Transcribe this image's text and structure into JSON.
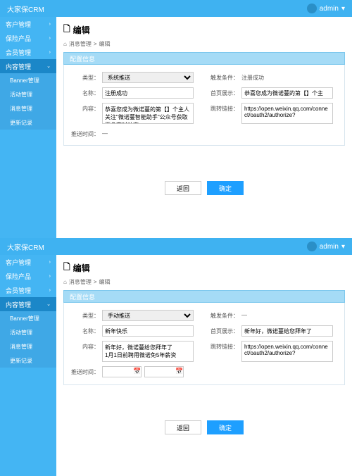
{
  "brand": "大家保CRM",
  "user": "admin",
  "sidebar": [
    {
      "label": "客户管理",
      "type": "top"
    },
    {
      "label": "保险产品",
      "type": "top"
    },
    {
      "label": "会员管理",
      "type": "top"
    },
    {
      "label": "内容管理",
      "type": "expand"
    },
    {
      "label": "Banner管理",
      "type": "sub"
    },
    {
      "label": "活动管理",
      "type": "sub"
    },
    {
      "label": "消息管理",
      "type": "act"
    },
    {
      "label": "更新记录",
      "type": "sub"
    }
  ],
  "page": {
    "icon": "📄",
    "title": "编辑",
    "home": "⌂",
    "bc1": "消息管理",
    "bc2": "编辑",
    "section": "配置信息"
  },
  "labels": {
    "type": "类型：",
    "name": "名称：",
    "content": "内容：",
    "pushTime": "推送时间：",
    "trigger": "触发条件：",
    "homeShow": "首页展示：",
    "jumpLink": "跳转链接："
  },
  "btns": {
    "back": "返回",
    "ok": "确定"
  },
  "inst": [
    {
      "type": "系统推送",
      "name": "注册成功",
      "content": "恭喜您成为微诺蔓的第【】个主人\n关注\"微诺蔓智能助手\"公众号获取更多实时动态",
      "pushTime": "—",
      "trigger": "注册成功",
      "homeShow": "恭喜您成为微诺蔓的第【】个主",
      "jumpLink": "https://open.weixin.qq.com/connect/oauth2/authorize?"
    },
    {
      "type": "手动推送",
      "name": "新年快乐",
      "content": "新年好，微诺蔓给您拜年了\n1月1日前聘用微诺免5年薪资",
      "pushTime": "",
      "trigger": "—",
      "homeShow": "新年好，微诺蔓给您拜年了",
      "jumpLink": "https://open.weixin.qq.com/connect/oauth2/authorize?",
      "dates": true
    }
  ]
}
